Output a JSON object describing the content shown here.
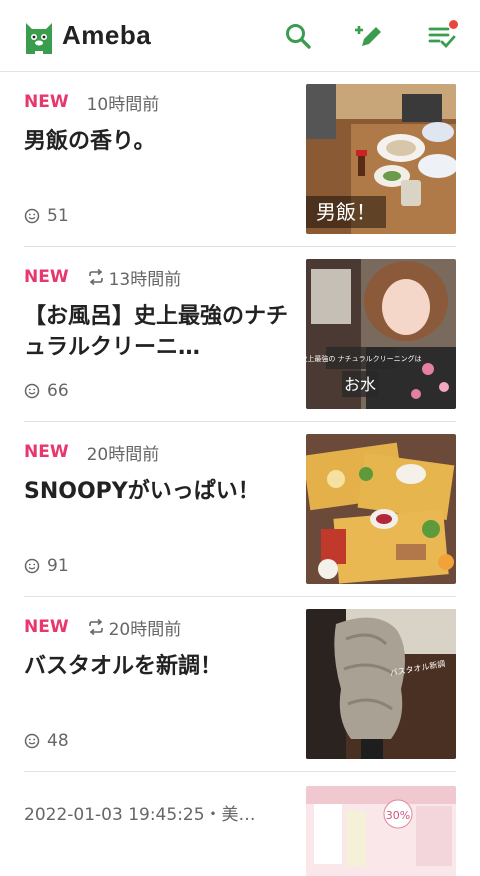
{
  "header": {
    "logo_text": "Ameba",
    "icons": [
      "search-icon",
      "write-post-icon",
      "reader-list-icon"
    ],
    "brand_color": "#3a9d4e",
    "notification_dot_color": "#e8483e"
  },
  "feed": [
    {
      "badge": "NEW",
      "reblogged": false,
      "time": "10時間前",
      "title": "男飯の香り。",
      "likes": "51",
      "thumb_caption": "男飯！"
    },
    {
      "badge": "NEW",
      "reblogged": true,
      "time": "13時間前",
      "title": "【お風呂】史上最強のナチュラルクリーニ…",
      "likes": "66",
      "thumb_caption": "お水",
      "thumb_caption_small": "史上最強の ナチュラルクリーニングは"
    },
    {
      "badge": "NEW",
      "reblogged": false,
      "time": "20時間前",
      "title": "SNOOPYがいっぱい！",
      "likes": "91"
    },
    {
      "badge": "NEW",
      "reblogged": true,
      "time": "20時間前",
      "title": "バスタオルを新調！",
      "likes": "48",
      "thumb_caption": "バスタオル新調"
    }
  ],
  "partial": {
    "meta": "2022-01-03 19:45:25・美…",
    "thumb_label": "30%"
  },
  "colors": {
    "new_badge": "#e8376c",
    "meta_text": "#666666",
    "title_text": "#222222"
  }
}
